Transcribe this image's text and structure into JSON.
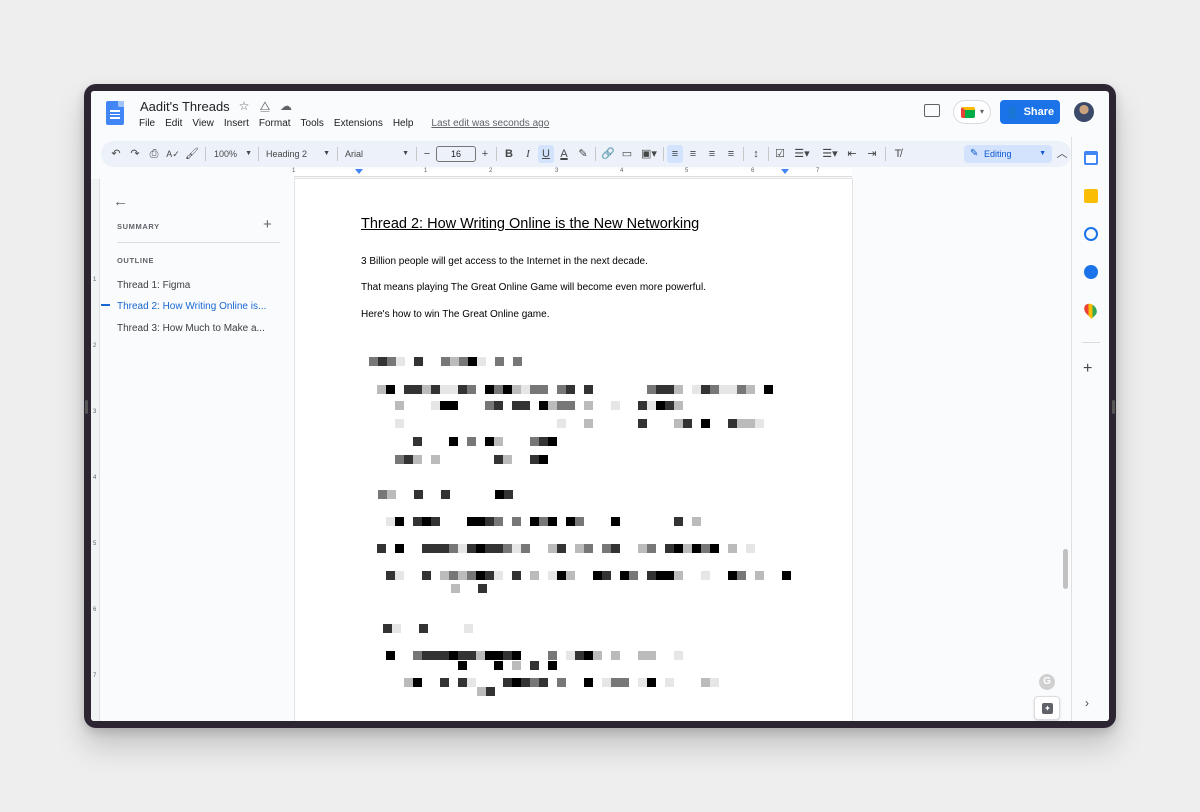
{
  "app": {
    "title": "Aadit's Threads",
    "menu": [
      "File",
      "Edit",
      "View",
      "Insert",
      "Format",
      "Tools",
      "Extensions",
      "Help"
    ],
    "last_edit": "Last edit was seconds ago",
    "share_label": "Share"
  },
  "toolbar": {
    "zoom": "100%",
    "style": "Heading 2",
    "font": "Arial",
    "font_size": "16",
    "mode": "Editing"
  },
  "outline_panel": {
    "summary_label": "SUMMARY",
    "outline_label": "OUTLINE",
    "items": [
      {
        "label": "Thread 1: Figma",
        "active": false
      },
      {
        "label": "Thread 2: How Writing Online is...",
        "active": true
      },
      {
        "label": "Thread 3: How Much to Make a...",
        "active": false
      }
    ]
  },
  "document": {
    "heading": "Thread 2: How Writing Online is the New Networking",
    "paragraphs": [
      "3 Billion people will get access to the Internet in the next decade.",
      "That means playing The Great Online Game will become even more powerful.",
      "Here's how to win The Great Online game."
    ]
  },
  "ruler": {
    "numbers": [
      "1",
      "1",
      "2",
      "3",
      "4",
      "5",
      "6",
      "7"
    ],
    "vertical_numbers": [
      "1",
      "2",
      "3",
      "4",
      "5",
      "6",
      "7"
    ]
  },
  "colors": {
    "accent": "#1a73e8",
    "active_outline": "#1967d2",
    "editing_bg": "#d3e3fd"
  },
  "icons": {
    "rail": [
      "calendar-icon",
      "keep-icon",
      "tasks-icon",
      "contacts-icon",
      "maps-icon"
    ]
  }
}
